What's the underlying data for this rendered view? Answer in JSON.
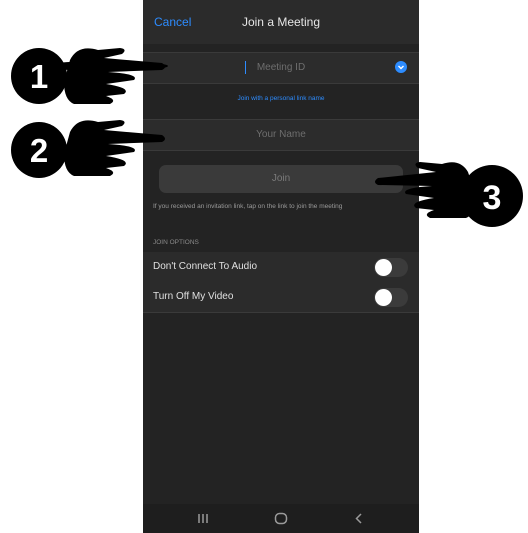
{
  "header": {
    "cancel_label": "Cancel",
    "title": "Join a Meeting"
  },
  "meeting_id": {
    "placeholder": "Meeting ID",
    "dropdown_icon": "chevron-down-circle-icon"
  },
  "personal_link_label": "Join with a personal link name",
  "name_field": {
    "placeholder": "Your Name"
  },
  "join_button": {
    "label": "Join"
  },
  "hint_text": "If you received an invitation link, tap on the link to join the meeting",
  "join_options": {
    "heading": "JOIN OPTIONS",
    "items": [
      {
        "label": "Don't Connect To Audio",
        "on": false
      },
      {
        "label": "Turn Off My Video",
        "on": false
      }
    ]
  },
  "nav": {
    "recents": "recents-icon",
    "home": "home-icon",
    "back": "back-icon"
  },
  "markers": [
    "1",
    "2",
    "3"
  ],
  "colors": {
    "accent": "#2d8cff",
    "background": "#232323",
    "marker": "#000000"
  }
}
